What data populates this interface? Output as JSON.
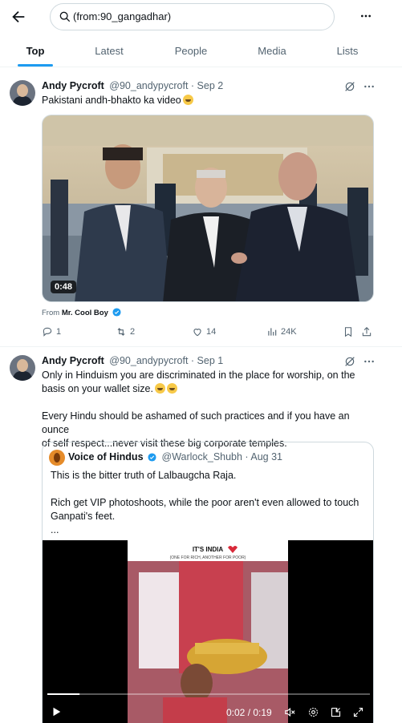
{
  "search": {
    "query": "(from:90_gangadhar)"
  },
  "tabs": [
    {
      "label": "Top"
    },
    {
      "label": "Latest"
    },
    {
      "label": "People"
    },
    {
      "label": "Media"
    },
    {
      "label": "Lists"
    }
  ],
  "tweets": [
    {
      "name": "Andy Pycroft",
      "meta": "@90_andypycroft · Sep 2",
      "text": "Pakistani andh-bhakto ka video",
      "media": {
        "duration": "0:48"
      },
      "from_prefix": "From",
      "from_name": "Mr. Cool Boy",
      "stats": {
        "replies": "1",
        "reposts": "2",
        "likes": "14",
        "views": "24K"
      }
    },
    {
      "name": "Andy Pycroft",
      "meta": "@90_andypycroft · Sep 1",
      "line1": "Only in Hinduism you are discriminated in the place for worship, on the",
      "line2": "basis on your wallet size.",
      "para2_line1": "Every Hindu should be ashamed of such practices and if you have an ounce",
      "para2_line2": "of self respect...never visit these big corporate temples.",
      "quote": {
        "name": "Voice of Hindus",
        "meta": "@Warlock_Shubh · Aug 31",
        "text1": "This is the bitter truth of Lalbaugcha Raja.",
        "text2": "Rich get VIP photoshoots, while the poor aren't even allowed to touch",
        "text3": "Ganpati's feet.",
        "text4": "...",
        "video": {
          "caption_title": "IT'S INDIA",
          "caption_sub": "(ONE FOR RICH, ANOTHER FOR POOR)",
          "time": "0:02 / 0:19",
          "progress": 0.1
        }
      }
    }
  ],
  "colors": {
    "accent": "#1d9bf0",
    "muted": "#536471",
    "text": "#0f1419"
  },
  "icons": [
    "back-arrow-icon",
    "search-icon",
    "more-icon",
    "grok-icon",
    "reply-icon",
    "repost-icon",
    "like-icon",
    "views-icon",
    "bookmark-icon",
    "share-icon",
    "verified-icon",
    "play-icon",
    "mute-icon",
    "settings-icon",
    "pip-icon",
    "fullscreen-icon"
  ]
}
